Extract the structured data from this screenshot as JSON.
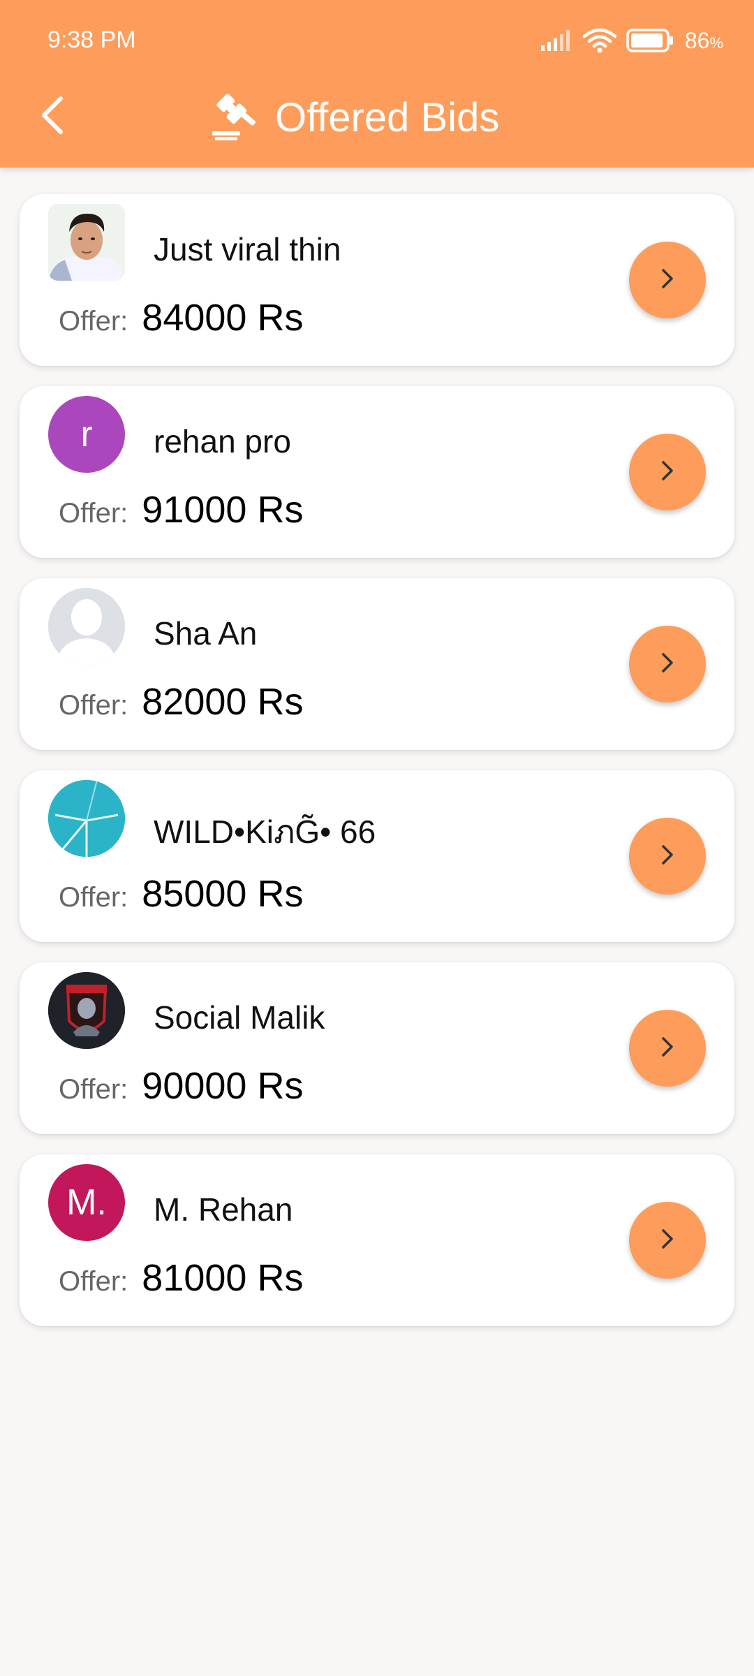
{
  "status_bar": {
    "time": "9:38 PM",
    "battery_percent": "86",
    "battery_unit": "%",
    "icons": [
      "signal-icon",
      "wifi-icon",
      "battery-icon"
    ]
  },
  "header": {
    "title": "Offered Bids",
    "back_icon": "chevron-left-icon",
    "title_icon": "gavel-icon",
    "background_color": "#fe9d5b"
  },
  "bids": [
    {
      "name": "Just viral thin",
      "offer_label": "Offer:",
      "amount": "84000 Rs",
      "avatar": "photo"
    },
    {
      "name": "rehan pro",
      "offer_label": "Offer:",
      "amount": "91000 Rs",
      "avatar": "letter",
      "avatar_text": "r",
      "avatar_color": "#ab47bc"
    },
    {
      "name": "Sha An",
      "offer_label": "Offer:",
      "amount": "82000 Rs",
      "avatar": "placeholder"
    },
    {
      "name": "WILD•KiภG̃• 66",
      "offer_label": "Offer:",
      "amount": "85000 Rs",
      "avatar": "image"
    },
    {
      "name": "Social Malik",
      "offer_label": "Offer:",
      "amount": "90000 Rs",
      "avatar": "logo"
    },
    {
      "name": "M. Rehan",
      "offer_label": "Offer:",
      "amount": "81000 Rs",
      "avatar": "letter",
      "avatar_text": "M.",
      "avatar_color": "#c2185b"
    }
  ],
  "accent_color": "#fe9d5b"
}
